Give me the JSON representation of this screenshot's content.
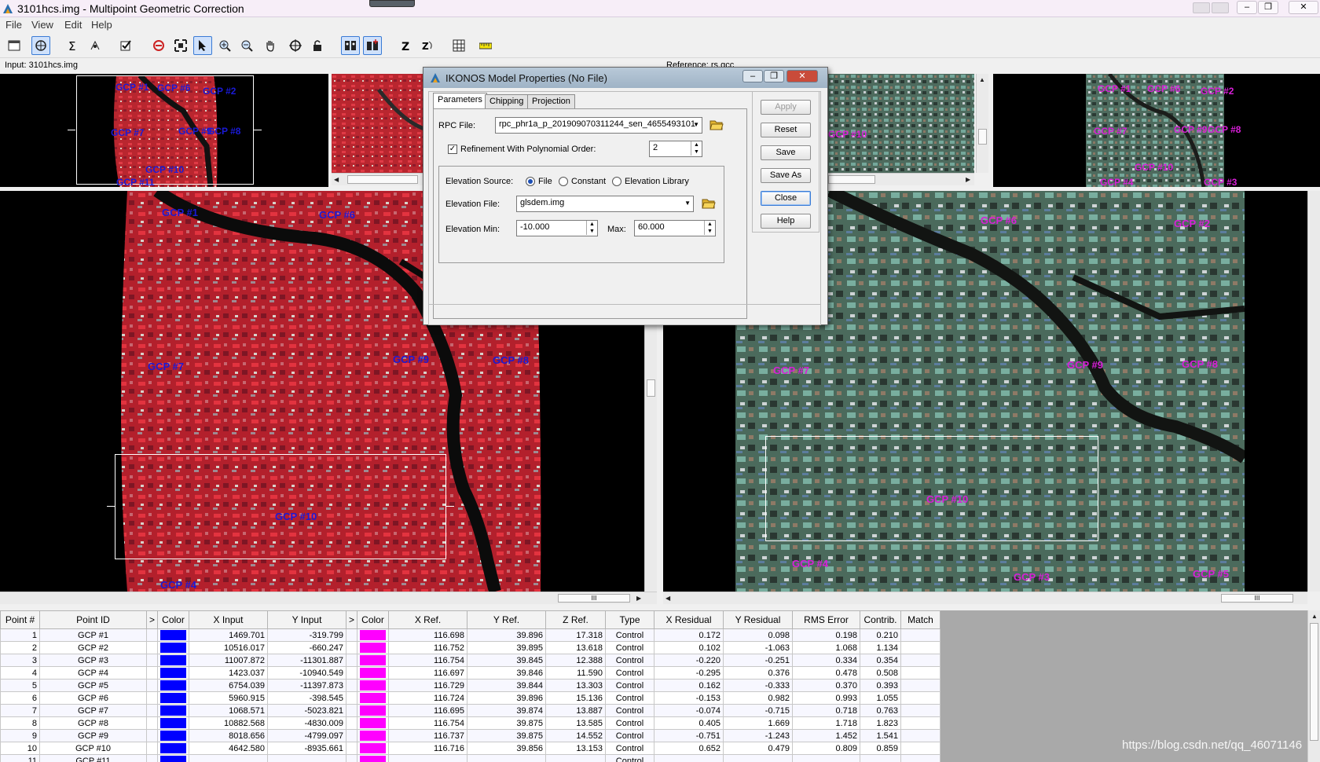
{
  "window": {
    "title": "3101hcs.img - Multipoint Geometric Correction",
    "minimize_glyph": "–",
    "restore_glyph": "❐",
    "close_glyph": "✕"
  },
  "menu": {
    "file": "File",
    "view": "View",
    "edit": "Edit",
    "help": "Help"
  },
  "toolbar_icons": [
    "window-icon",
    "gcp-tool-icon",
    "sigma-icon",
    "move-icon",
    "check-icon",
    "link-icon",
    "fit-icon",
    "select-arrow-icon",
    "zoom-in-icon",
    "zoom-out-icon",
    "pan-hand-icon",
    "crosshair-icon",
    "lock-icon",
    "points-icon",
    "points-add-icon",
    "z-icon",
    "z-cycle-icon",
    "grid-icon",
    "ruler-icon"
  ],
  "views": {
    "input_label": "Input: 3101hcs.img",
    "reference_label": "Reference: rs.gcc",
    "scroll_thumb": "III"
  },
  "gcp_markers": {
    "input_overview": [
      "GCP #1",
      "GCP #6",
      "GCP #2",
      "GCP #7",
      "GCP #9",
      "GCP #8",
      "GCP #10",
      "GCP #11"
    ],
    "input_main": [
      "GCP #1",
      "GCP #6",
      "GCP #7",
      "GCP #9",
      "GCP #8",
      "GCP #10",
      "GCP #4"
    ],
    "ref_overview": [
      "GCP #1",
      "GCP #6",
      "GCP #2",
      "GCP #7",
      "GCP #9",
      "GCP #8",
      "GCP #10",
      "GCP #4",
      "GCP #3"
    ],
    "ref_main": [
      "GCP #6",
      "GCP #2",
      "GCP #7",
      "GCP #9",
      "GCP #8",
      "GCP #10",
      "GCP #4",
      "GCP #3",
      "GCP #5"
    ],
    "ref_overview_left": "GCP #10"
  },
  "colors": {
    "input_marker": "#1a1ad6",
    "ref_marker": "#d81fd8",
    "input_swatch": "#0000ff",
    "ref_swatch": "#ff00ff"
  },
  "dialog": {
    "title": "IKONOS Model Properties (No File)",
    "tabs": {
      "parameters": "Parameters",
      "chipping": "Chipping",
      "projection": "Projection"
    },
    "rpc_label": "RPC File:",
    "rpc_value": "rpc_phr1a_p_201909070311244_sen_4655493101",
    "refinement_label": "Refinement With Polynomial Order:",
    "refinement_checked": true,
    "refinement_check_glyph": "✓",
    "poly_order": "2",
    "elev_source_label": "Elevation Source:",
    "elev_file_opt": "File",
    "elev_constant_opt": "Constant",
    "elev_library_opt": "Elevation Library",
    "elev_file_label": "Elevation File:",
    "elev_file_value": "glsdem.img",
    "elev_min_label": "Elevation Min:",
    "elev_min_value": "-10.000",
    "max_label": "Max:",
    "max_value": "60.000",
    "buttons": {
      "apply": "Apply",
      "reset": "Reset",
      "save": "Save",
      "save_as": "Save As",
      "close": "Close",
      "help": "Help"
    }
  },
  "table": {
    "headers": [
      "Point #",
      "Point ID",
      ">",
      "Color",
      "X Input",
      "Y Input",
      ">",
      "Color",
      "X Ref.",
      "Y Ref.",
      "Z Ref.",
      "Type",
      "X Residual",
      "Y Residual",
      "RMS Error",
      "Contrib.",
      "Match"
    ],
    "rows": [
      {
        "n": "1",
        "id": "GCP #1",
        "xi": "1469.701",
        "yi": "-319.799",
        "xr": "116.698",
        "yr": "39.896",
        "zr": "17.318",
        "type": "Control",
        "xres": "0.172",
        "yres": "0.098",
        "rms": "0.198",
        "contrib": "0.210"
      },
      {
        "n": "2",
        "id": "GCP #2",
        "xi": "10516.017",
        "yi": "-660.247",
        "xr": "116.752",
        "yr": "39.895",
        "zr": "13.618",
        "type": "Control",
        "xres": "0.102",
        "yres": "-1.063",
        "rms": "1.068",
        "contrib": "1.134"
      },
      {
        "n": "3",
        "id": "GCP #3",
        "xi": "11007.872",
        "yi": "-11301.887",
        "xr": "116.754",
        "yr": "39.845",
        "zr": "12.388",
        "type": "Control",
        "xres": "-0.220",
        "yres": "-0.251",
        "rms": "0.334",
        "contrib": "0.354"
      },
      {
        "n": "4",
        "id": "GCP #4",
        "xi": "1423.037",
        "yi": "-10940.549",
        "xr": "116.697",
        "yr": "39.846",
        "zr": "11.590",
        "type": "Control",
        "xres": "-0.295",
        "yres": "0.376",
        "rms": "0.478",
        "contrib": "0.508"
      },
      {
        "n": "5",
        "id": "GCP #5",
        "xi": "6754.039",
        "yi": "-11397.873",
        "xr": "116.729",
        "yr": "39.844",
        "zr": "13.303",
        "type": "Control",
        "xres": "0.162",
        "yres": "-0.333",
        "rms": "0.370",
        "contrib": "0.393"
      },
      {
        "n": "6",
        "id": "GCP #6",
        "xi": "5960.915",
        "yi": "-398.545",
        "xr": "116.724",
        "yr": "39.896",
        "zr": "15.136",
        "type": "Control",
        "xres": "-0.153",
        "yres": "0.982",
        "rms": "0.993",
        "contrib": "1.055"
      },
      {
        "n": "7",
        "id": "GCP #7",
        "xi": "1068.571",
        "yi": "-5023.821",
        "xr": "116.695",
        "yr": "39.874",
        "zr": "13.887",
        "type": "Control",
        "xres": "-0.074",
        "yres": "-0.715",
        "rms": "0.718",
        "contrib": "0.763"
      },
      {
        "n": "8",
        "id": "GCP #8",
        "xi": "10882.568",
        "yi": "-4830.009",
        "xr": "116.754",
        "yr": "39.875",
        "zr": "13.585",
        "type": "Control",
        "xres": "0.405",
        "yres": "1.669",
        "rms": "1.718",
        "contrib": "1.823"
      },
      {
        "n": "9",
        "id": "GCP #9",
        "xi": "8018.656",
        "yi": "-4799.097",
        "xr": "116.737",
        "yr": "39.875",
        "zr": "14.552",
        "type": "Control",
        "xres": "-0.751",
        "yres": "-1.243",
        "rms": "1.452",
        "contrib": "1.541"
      },
      {
        "n": "10",
        "id": "GCP #10",
        "xi": "4642.580",
        "yi": "-8935.661",
        "xr": "116.716",
        "yr": "39.856",
        "zr": "13.153",
        "type": "Control",
        "xres": "0.652",
        "yres": "0.479",
        "rms": "0.809",
        "contrib": "0.859"
      },
      {
        "n": "11",
        "id": "GCP #11",
        "xi": "",
        "yi": "",
        "xr": "",
        "yr": "",
        "zr": "",
        "type": "Control",
        "xres": "",
        "yres": "",
        "rms": "",
        "contrib": ""
      }
    ]
  },
  "watermark": "https://blog.csdn.net/qq_46071146"
}
